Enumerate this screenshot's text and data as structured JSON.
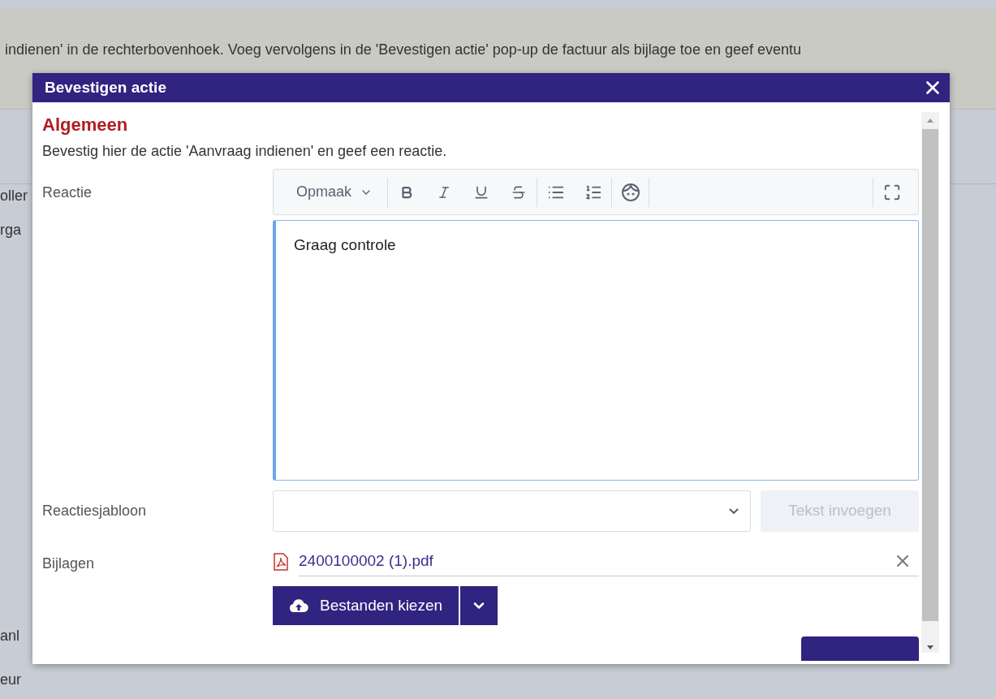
{
  "background": {
    "instruction": "indienen' in de rechterbovenhoek. Voeg vervolgens in de 'Bevestigen actie' pop-up de factuur als bijlage toe en geef eventu",
    "side_labels": [
      "oller",
      "rga",
      "anl",
      "eur"
    ]
  },
  "dialog": {
    "title": "Bevestigen actie",
    "section": "Algemeen",
    "description": "Bevestig hier de actie 'Aanvraag indienen' en geef een reactie.",
    "reaction": {
      "label": "Reactie",
      "format_menu": "Opmaak",
      "value": "Graag controle"
    },
    "template": {
      "label": "Reactiesjabloon",
      "insert_button": "Tekst invoegen",
      "insert_disabled": true
    },
    "attachments": {
      "label": "Bijlagen",
      "files": [
        {
          "name": "2400100002 (1).pdf"
        }
      ],
      "choose_button": "Bestanden kiezen"
    }
  }
}
